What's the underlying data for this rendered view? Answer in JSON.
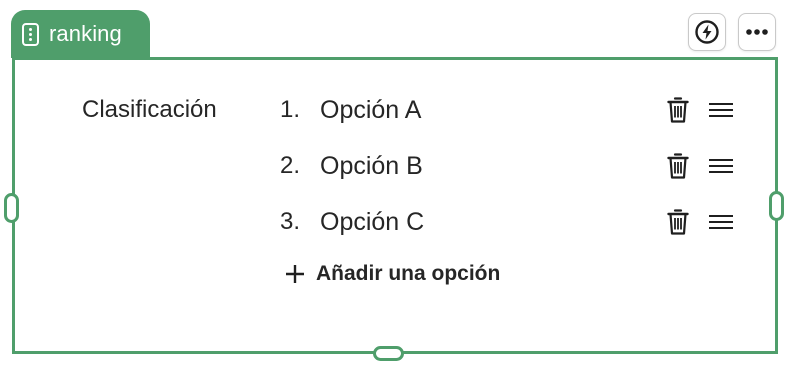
{
  "block": {
    "tab_label": "ranking",
    "accent_color": "#4f9e6b"
  },
  "toolbar": {
    "bolt_icon": "lightning-bolt-icon",
    "more_icon": "more-horizontal-icon"
  },
  "question": {
    "label": "Clasificación",
    "options": [
      {
        "number": "1.",
        "label": "Opción A"
      },
      {
        "number": "2.",
        "label": "Opción B"
      },
      {
        "number": "3.",
        "label": "Opción C"
      }
    ],
    "add_label": "Añadir una opción"
  }
}
